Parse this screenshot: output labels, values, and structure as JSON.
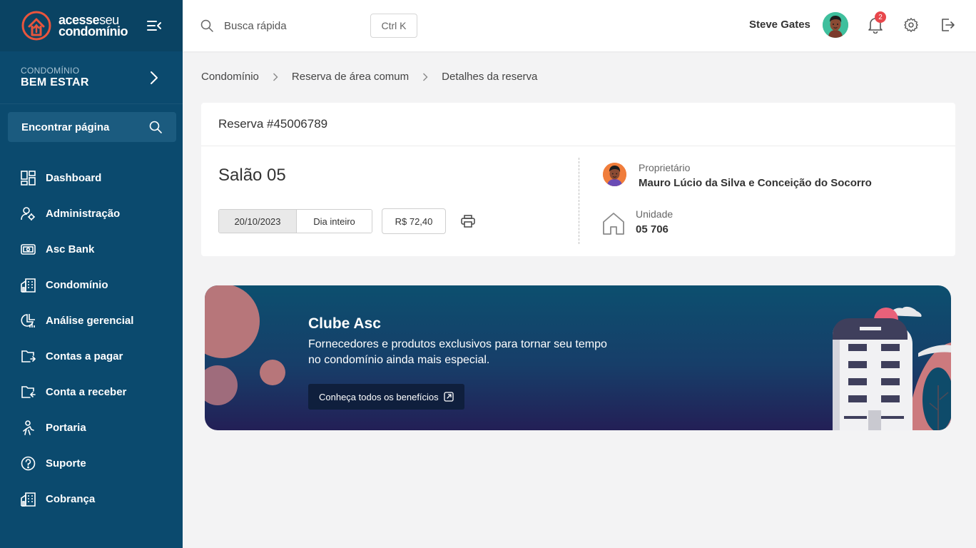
{
  "brand": {
    "line1_bold": "acesse",
    "line1_thin": "seu",
    "line2": "condomínio"
  },
  "sidebar": {
    "condo_caption": "CONDOMÍNIO",
    "condo_name": "BEM ESTAR",
    "find_page": "Encontrar página",
    "items": [
      {
        "label": "Dashboard",
        "icon": "dashboard-icon"
      },
      {
        "label": "Administração",
        "icon": "admin-icon"
      },
      {
        "label": "Asc Bank",
        "icon": "bank-icon"
      },
      {
        "label": "Condomínio",
        "icon": "building-icon"
      },
      {
        "label": "Análise gerencial",
        "icon": "analytics-icon"
      },
      {
        "label": "Contas a pagar",
        "icon": "folder-out-icon"
      },
      {
        "label": "Conta a receber",
        "icon": "folder-in-icon"
      },
      {
        "label": "Portaria",
        "icon": "gatekeeper-icon"
      },
      {
        "label": "Suporte",
        "icon": "help-icon"
      },
      {
        "label": "Cobrança",
        "icon": "building-icon"
      }
    ]
  },
  "header": {
    "search_placeholder": "Busca rápida",
    "shortcut": "Ctrl K",
    "user_name": "Steve Gates",
    "notification_count": "2"
  },
  "breadcrumb": [
    "Condomínio",
    "Reserva de área comum",
    "Detalhes da reserva"
  ],
  "reservation": {
    "title": "Reserva #45006789",
    "area": "Salão 05",
    "date": "20/10/2023",
    "period": "Dia inteiro",
    "price": "R$ 72,40",
    "owner_caption": "Proprietário",
    "owner_name": "Mauro Lúcio da Silva e Conceição do Socorro",
    "unit_caption": "Unidade",
    "unit_value": "05 706"
  },
  "banner": {
    "title": "Clube Asc",
    "text": "Fornecedores e produtos exclusivos para tornar seu tempo no condomínio ainda mais especial.",
    "button": "Conheça todos os benefícios"
  },
  "colors": {
    "sidebar": "#0b4a6e",
    "logo_accent": "#e8553d",
    "banner_dark": "#231f56",
    "badge": "#e8474c"
  }
}
